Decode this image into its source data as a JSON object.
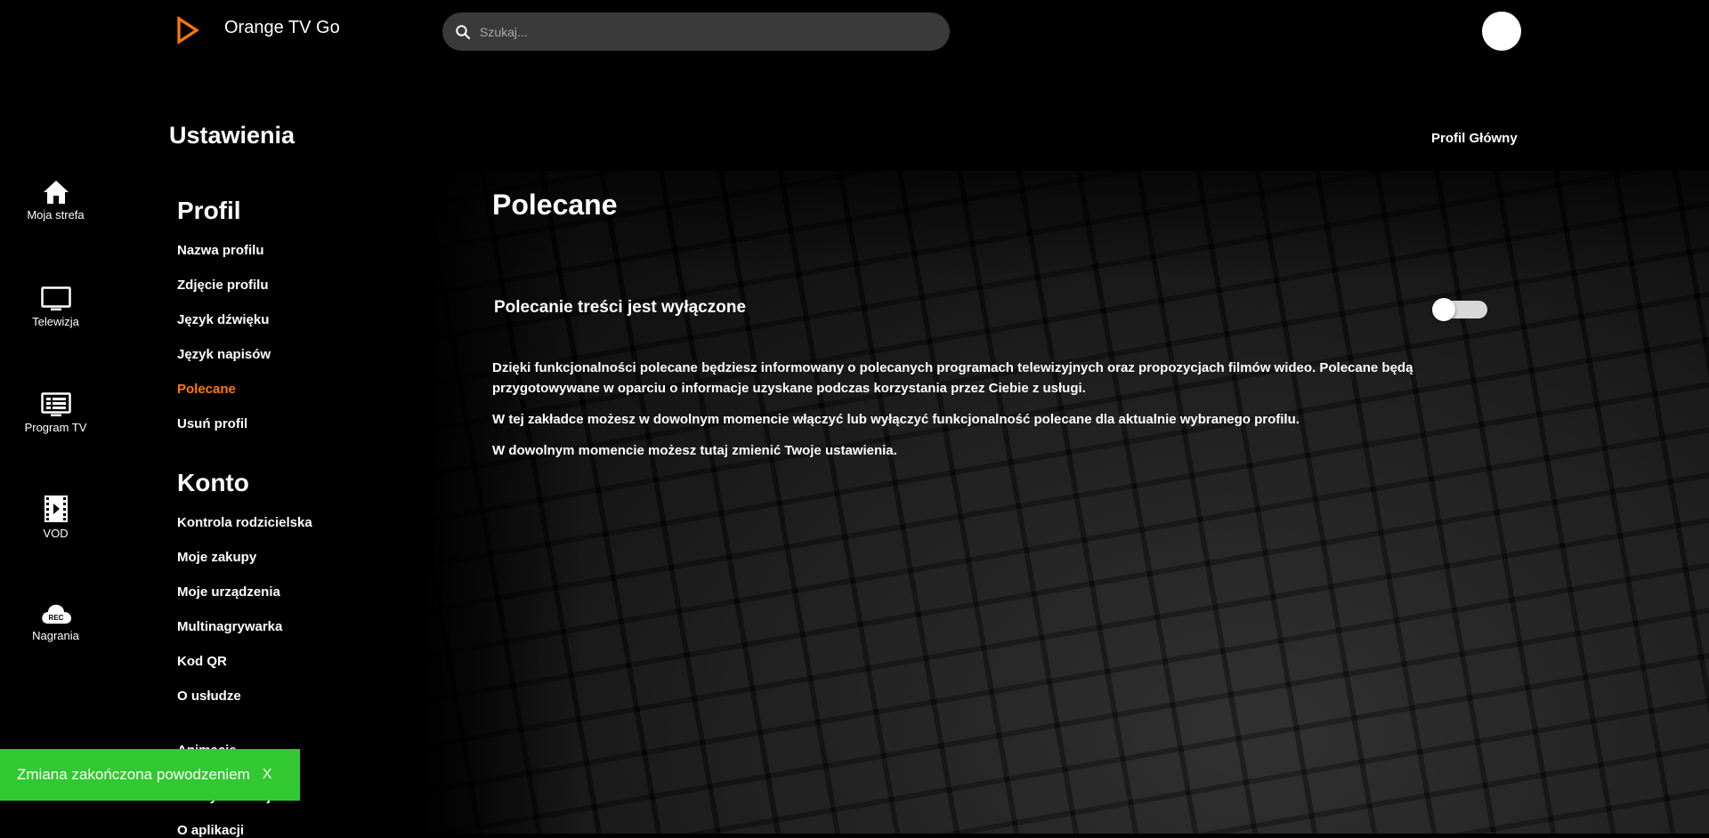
{
  "header": {
    "brand": "Orange TV Go",
    "search_placeholder": "Szukaj..."
  },
  "nav": [
    {
      "label": "Moja strefa",
      "icon": "home-icon"
    },
    {
      "label": "Telewizja",
      "icon": "tv-icon"
    },
    {
      "label": "Program TV",
      "icon": "tv-guide-icon"
    },
    {
      "label": "VOD",
      "icon": "film-icon"
    },
    {
      "label": "Nagrania",
      "icon": "rec-cloud-icon"
    }
  ],
  "settings": {
    "title": "Ustawienia",
    "profile_name": "Profil Główny",
    "sections": [
      {
        "heading": "Profil",
        "items": [
          "Nazwa profilu",
          "Zdjęcie profilu",
          "Język dźwięku",
          "Język napisów",
          "Polecane",
          "Usuń profil"
        ]
      },
      {
        "heading": "Konto",
        "items": [
          "Kontrola rodzicielska",
          "Moje zakupy",
          "Moje urządzenia",
          "Multinagrywarka",
          "Kod QR",
          "O usłudze",
          "Animacje",
          "Efekty animacji",
          "O aplikacji"
        ]
      }
    ],
    "active_item": "Polecane"
  },
  "content": {
    "title": "Polecane",
    "toggle_label": "Polecanie treści jest wyłączone",
    "toggle_on": false,
    "paragraphs": [
      "Dzięki funkcjonalności polecane będziesz informowany o polecanych programach telewizyjnych oraz propozycjach filmów wideo. Polecane będą przygotowywane w oparciu o informacje uzyskane podczas korzystania przez Ciebie z usługi.",
      "W tej zakładce możesz w dowolnym momencie włączyć lub wyłączyć funkcjonalność polecane dla aktualnie wybranego profilu.",
      "W dowolnym momencie możesz tutaj zmienić Twoje ustawienia."
    ]
  },
  "toast": {
    "message": "Zmiana zakończona powodzeniem",
    "close_label": "X"
  },
  "colors": {
    "accent": "#ff7900",
    "success": "#32c832",
    "search_bg": "#3a3a3a"
  }
}
